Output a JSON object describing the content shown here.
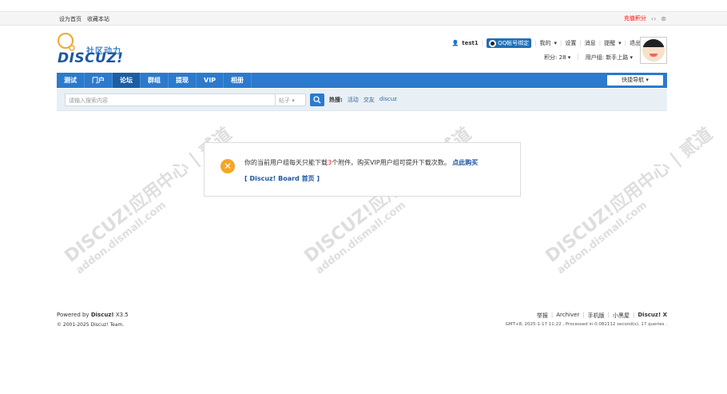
{
  "topbar": {
    "set_home": "设为首页",
    "bookmark": "收藏本站",
    "recharge": "充值积分",
    "code_icon": "code-icon",
    "refresh_icon": "refresh-icon"
  },
  "logo": {
    "cn": "社区动力",
    "en": "DISCUZ!"
  },
  "user": {
    "name": "test1",
    "qq_bind": "QQ帐号绑定",
    "my": "我的",
    "settings": "设置",
    "messages": "消息",
    "reminders": "提醒",
    "logout": "退出",
    "points": "积分: 28",
    "group": "用户组: 新手上路"
  },
  "nav": {
    "items": [
      "测试",
      "门户",
      "论坛",
      "群组",
      "提现",
      "VIP",
      "相册"
    ],
    "active_index": 2,
    "quick_nav": "快捷导航"
  },
  "search": {
    "placeholder": "请输入搜索内容",
    "type": "帖子",
    "hot_label": "热搜:",
    "hot_links": [
      "活动",
      "交友",
      "discuz"
    ]
  },
  "watermark": {
    "line1": "DISCUZ!应用中心 | 贰道",
    "line2": "addon.dismall.com"
  },
  "message": {
    "text_before": "你的当前用户组每天只能下载",
    "count": "3",
    "text_after": "个附件。购买VIP用户组可提升下载次数。",
    "buy_link": "点此购买",
    "home_link": "[ Discuz! Board 首页 ]"
  },
  "footer": {
    "powered_prefix": "Powered by",
    "powered_name": "Discuz!",
    "version": "X3.5",
    "copyright": "© 2001-2025 Discuz! Team.",
    "links": [
      "举报",
      "Archiver",
      "手机版",
      "小黑屋"
    ],
    "brand": "Discuz! X",
    "meta": "GMT+8, 2025-1-17 11:22 , Processed in 0.082112 second(s), 17 queries ."
  },
  "colors": {
    "nav_bg": "#2b7acd",
    "nav_active": "#1b5ea4",
    "accent_red": "#e02020",
    "link_blue": "#1d57a3",
    "warn_orange": "#f5a623"
  }
}
